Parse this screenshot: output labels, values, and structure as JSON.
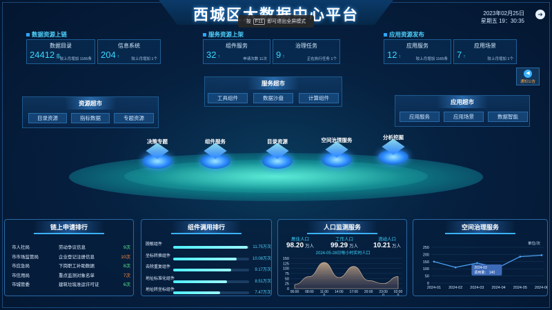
{
  "header": {
    "title": "西城区大数据中心平台",
    "toast_prefix": "按",
    "toast_key": "F11",
    "toast_suffix": "即可退出全屏模式",
    "date": "2023年02月25日",
    "time": "星期五 19：30:35"
  },
  "data_resources": {
    "title": "数据资源上链",
    "catalog": {
      "label": "数据目录",
      "value": "24412",
      "unit": "条",
      "note": "较上月增加 1165条"
    },
    "systems": {
      "label": "信息系统",
      "value": "204",
      "arrow": "↑",
      "note": "较上月增加 1个"
    }
  },
  "service_resources": {
    "title": "服务资源上架",
    "components": {
      "label": "组件服务",
      "value": "32",
      "arrow": "↑",
      "note": "申请次数 11次"
    },
    "governance": {
      "label": "治理任务",
      "value": "9",
      "arrow": "↑",
      "note": "正在执行任务 1个"
    }
  },
  "app_resources": {
    "title": "应用资源发布",
    "services": {
      "label": "应用服务",
      "value": "12",
      "arrow": "↑",
      "note": "较上月增加 1165条"
    },
    "scenes": {
      "label": "应用场景",
      "value": "7",
      "arrow": "↑",
      "note": "较上月增加 1个"
    }
  },
  "notice": {
    "label": "通知公告",
    "icon": "megaphone-icon"
  },
  "resource_market": {
    "title": "资源超市",
    "buttons": [
      "目录资源",
      "指标数据",
      "专题资源"
    ]
  },
  "service_market": {
    "title": "服务超市",
    "buttons": [
      "工具组件",
      "数据沙盘",
      "计算组件"
    ]
  },
  "app_market": {
    "title": "应用超市",
    "buttons": [
      "应用服务",
      "应用场景",
      "数据智能"
    ]
  },
  "nodes": [
    "决策专题",
    "组件服务",
    "目录资源",
    "空间治理服务",
    "分析挖掘"
  ],
  "apply_rank": {
    "title": "链上申请排行",
    "rows": [
      {
        "org": "市人社局",
        "item": "劳动争议信息",
        "count": "9次"
      },
      {
        "org": "市市场监管局",
        "item": "企业登记注册信息",
        "count": "10次"
      },
      {
        "org": "市应急局",
        "item": "下岗职工补助数据",
        "count": "8次"
      },
      {
        "org": "市信用局",
        "item": "重点监测对象名单",
        "count": "7次"
      },
      {
        "org": "市城管委",
        "item": "建筑垃圾准运许可证",
        "count": "6次"
      }
    ]
  },
  "component_rank": {
    "title": "组件调用排行",
    "rows": [
      {
        "name": "脱敏组件",
        "value": "11.75万次",
        "fraction": 0.98
      },
      {
        "name": "坐标转换组件",
        "value": "10.08万次",
        "fraction": 0.84
      },
      {
        "name": "去除重复组件",
        "value": "9.17万次",
        "fraction": 0.76
      },
      {
        "name": "地址标准化组件",
        "value": "8.51万次",
        "fraction": 0.71
      },
      {
        "name": "地址转坐标组件",
        "value": "7.47万次",
        "fraction": 0.62
      }
    ]
  },
  "population": {
    "title": "人口监测服务",
    "kpis": [
      {
        "label": "居住人口",
        "value": "98.20",
        "unit": "万人"
      },
      {
        "label": "工作人口",
        "value": "99.29",
        "unit": "万人"
      },
      {
        "label": "流动人口",
        "value": "10.21",
        "unit": "万人"
      }
    ]
  },
  "spatial": {
    "title": "空间治理服务",
    "unit": "单位/次",
    "tooltip_date": "2024-03",
    "tooltip_label": "调用量：",
    "tooltip_value": "140"
  },
  "chart_data": [
    {
      "type": "area",
      "title": "2024-05-28日每小时实时人口",
      "x": [
        "05:00",
        "08:00",
        "11:00",
        "14:00",
        "17:00",
        "20:00",
        "23:00",
        "02:00"
      ],
      "x_sub": [
        "",
        "",
        "0",
        "",
        "",
        "",
        "0",
        "0"
      ],
      "y": [
        20,
        60,
        130,
        55,
        110,
        40,
        25,
        60
      ],
      "ylim": [
        0,
        150
      ],
      "yticks": [
        0,
        25,
        50,
        75,
        100,
        125,
        150
      ]
    },
    {
      "type": "line",
      "categories": [
        "2024-01",
        "2024-02",
        "2024-03",
        "2024-04",
        "2024-05",
        "2024-06"
      ],
      "values": [
        150,
        110,
        140,
        110,
        185,
        195
      ],
      "ylim": [
        0,
        250
      ],
      "yticks": [
        0,
        50,
        100,
        150,
        200,
        250
      ]
    }
  ]
}
